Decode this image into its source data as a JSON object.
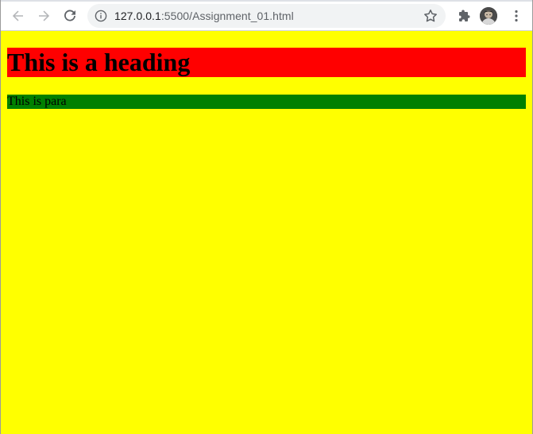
{
  "browser": {
    "address_bar": {
      "host": "127.0.0.1",
      "path": ":5500/Assignment_01.html"
    },
    "icons": {
      "back": "arrow-back-icon",
      "forward": "arrow-forward-icon",
      "reload": "reload-icon",
      "site_info": "info-icon",
      "bookmark": "star-icon",
      "extensions": "puzzle-icon",
      "profile": "avatar",
      "menu": "kebab-menu-icon"
    }
  },
  "page": {
    "background_color": "#ffff00",
    "heading": {
      "text": "This is a heading",
      "background_color": "#ff0000"
    },
    "paragraph": {
      "text": "This is para",
      "background_color": "#008000"
    }
  }
}
